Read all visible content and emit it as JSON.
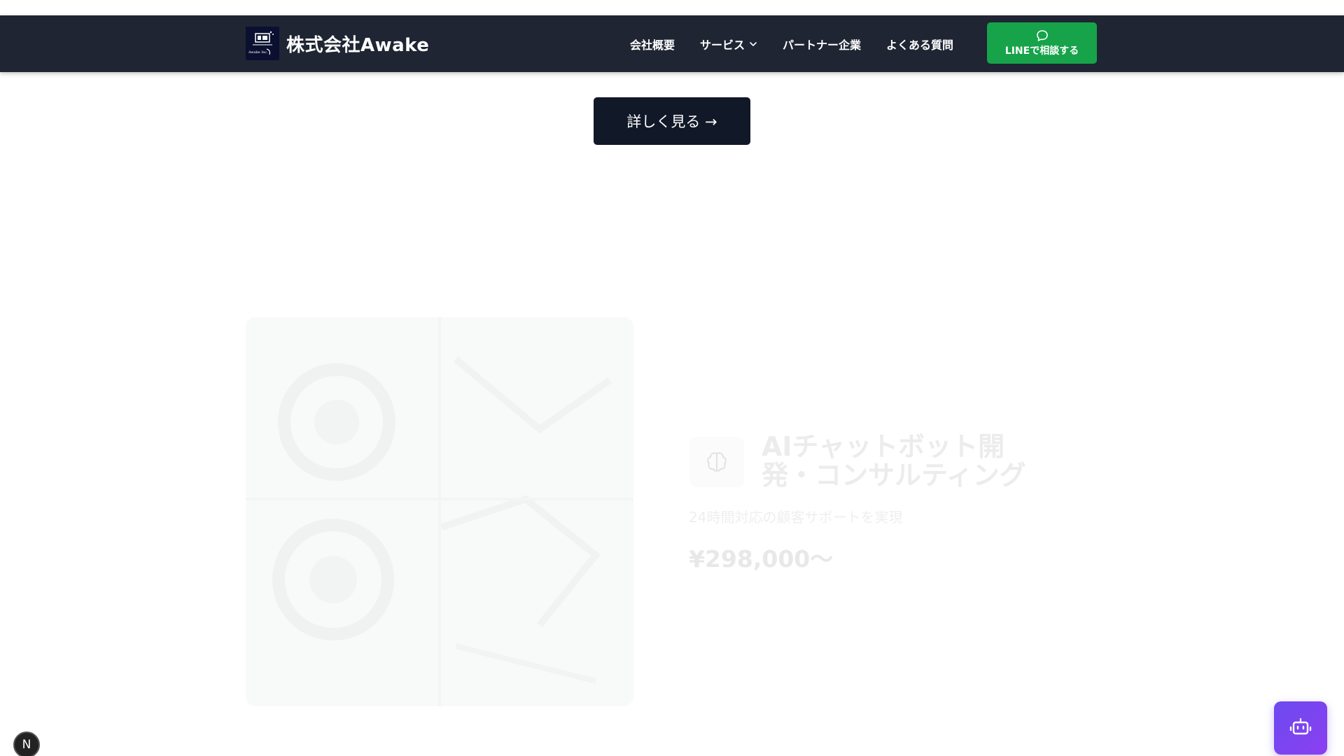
{
  "header": {
    "brand_name": "株式会社Awake",
    "logo_text": "Awake Inc.",
    "nav": [
      {
        "label": "会社概要"
      },
      {
        "label": "サービス"
      },
      {
        "label": "パートナー企業"
      },
      {
        "label": "よくある質問"
      }
    ],
    "line_button_label": "LINEで相談する"
  },
  "hero": {
    "detail_button_label": "詳しく見る →"
  },
  "service": {
    "title": "AIチャットボット開発・コンサルティング",
    "subtitle": "24時間対応の顧客サポートを実現",
    "price": "¥298,000〜"
  },
  "floating": {
    "next_badge": "N"
  },
  "colors": {
    "header_bg": "#1f2533",
    "line_green": "#16a34a",
    "dark_button": "#111827",
    "chatbot_purple": "#7c3aed"
  }
}
